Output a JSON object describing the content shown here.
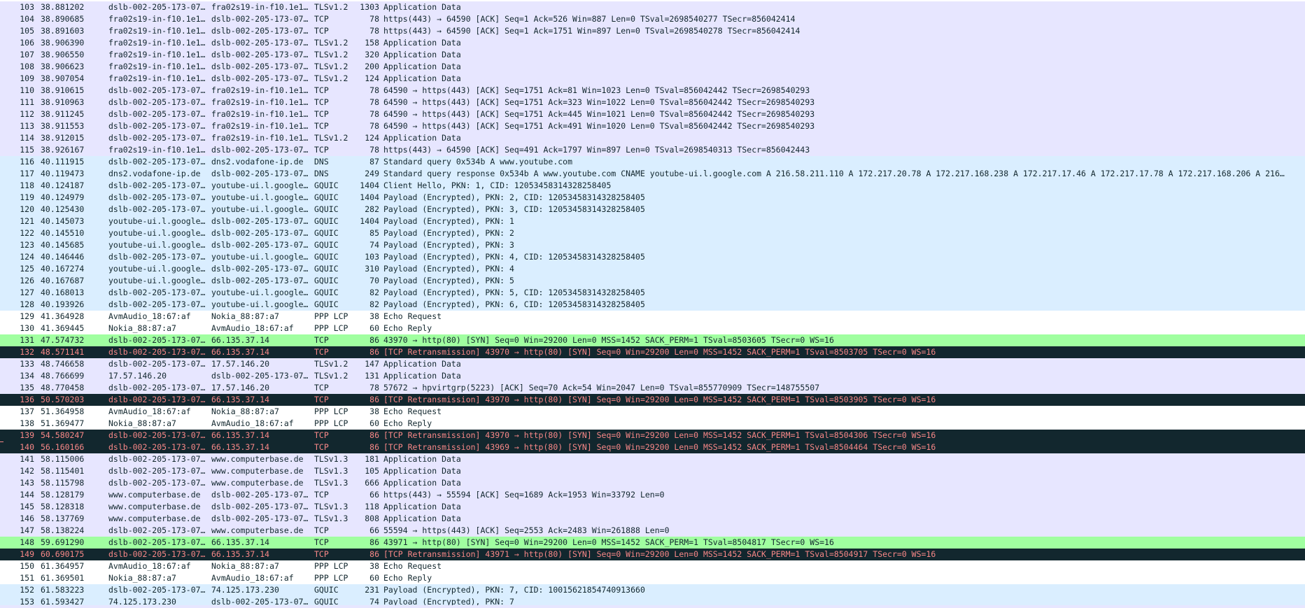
{
  "colors": {
    "tcp": "#e7e6ff",
    "udp": "#daeeff",
    "ppp": "#ffffff",
    "syn": "#a0ffa0",
    "bad": "#12272e"
  },
  "text_colors": {
    "tcp": "#12272e",
    "udp": "#12272e",
    "ppp": "#12272e",
    "syn": "#12272e",
    "bad": "#f78787"
  },
  "packets": [
    {
      "no": "103",
      "time": "38.881202",
      "src": "dslb-002-205-173-07…",
      "dst": "fra02s19-in-f10.1e1…",
      "proto": "TLSv1.2",
      "len": "1303",
      "info": "Application Data",
      "color": "tcp"
    },
    {
      "no": "104",
      "time": "38.890685",
      "src": "fra02s19-in-f10.1e1…",
      "dst": "dslb-002-205-173-07…",
      "proto": "TCP",
      "len": "78",
      "info": "https(443) → 64590 [ACK] Seq=1 Ack=526 Win=887 Len=0 TSval=2698540277 TSecr=856042414",
      "color": "tcp"
    },
    {
      "no": "105",
      "time": "38.891603",
      "src": "fra02s19-in-f10.1e1…",
      "dst": "dslb-002-205-173-07…",
      "proto": "TCP",
      "len": "78",
      "info": "https(443) → 64590 [ACK] Seq=1 Ack=1751 Win=897 Len=0 TSval=2698540278 TSecr=856042414",
      "color": "tcp"
    },
    {
      "no": "106",
      "time": "38.906390",
      "src": "fra02s19-in-f10.1e1…",
      "dst": "dslb-002-205-173-07…",
      "proto": "TLSv1.2",
      "len": "158",
      "info": "Application Data",
      "color": "tcp"
    },
    {
      "no": "107",
      "time": "38.906550",
      "src": "fra02s19-in-f10.1e1…",
      "dst": "dslb-002-205-173-07…",
      "proto": "TLSv1.2",
      "len": "320",
      "info": "Application Data",
      "color": "tcp"
    },
    {
      "no": "108",
      "time": "38.906623",
      "src": "fra02s19-in-f10.1e1…",
      "dst": "dslb-002-205-173-07…",
      "proto": "TLSv1.2",
      "len": "200",
      "info": "Application Data",
      "color": "tcp"
    },
    {
      "no": "109",
      "time": "38.907054",
      "src": "fra02s19-in-f10.1e1…",
      "dst": "dslb-002-205-173-07…",
      "proto": "TLSv1.2",
      "len": "124",
      "info": "Application Data",
      "color": "tcp"
    },
    {
      "no": "110",
      "time": "38.910615",
      "src": "dslb-002-205-173-07…",
      "dst": "fra02s19-in-f10.1e1…",
      "proto": "TCP",
      "len": "78",
      "info": "64590 → https(443) [ACK] Seq=1751 Ack=81 Win=1023 Len=0 TSval=856042442 TSecr=2698540293",
      "color": "tcp"
    },
    {
      "no": "111",
      "time": "38.910963",
      "src": "dslb-002-205-173-07…",
      "dst": "fra02s19-in-f10.1e1…",
      "proto": "TCP",
      "len": "78",
      "info": "64590 → https(443) [ACK] Seq=1751 Ack=323 Win=1022 Len=0 TSval=856042442 TSecr=2698540293",
      "color": "tcp"
    },
    {
      "no": "112",
      "time": "38.911245",
      "src": "dslb-002-205-173-07…",
      "dst": "fra02s19-in-f10.1e1…",
      "proto": "TCP",
      "len": "78",
      "info": "64590 → https(443) [ACK] Seq=1751 Ack=445 Win=1021 Len=0 TSval=856042442 TSecr=2698540293",
      "color": "tcp"
    },
    {
      "no": "113",
      "time": "38.911553",
      "src": "dslb-002-205-173-07…",
      "dst": "fra02s19-in-f10.1e1…",
      "proto": "TCP",
      "len": "78",
      "info": "64590 → https(443) [ACK] Seq=1751 Ack=491 Win=1020 Len=0 TSval=856042442 TSecr=2698540293",
      "color": "tcp"
    },
    {
      "no": "114",
      "time": "38.912015",
      "src": "dslb-002-205-173-07…",
      "dst": "fra02s19-in-f10.1e1…",
      "proto": "TLSv1.2",
      "len": "124",
      "info": "Application Data",
      "color": "tcp"
    },
    {
      "no": "115",
      "time": "38.926167",
      "src": "fra02s19-in-f10.1e1…",
      "dst": "dslb-002-205-173-07…",
      "proto": "TCP",
      "len": "78",
      "info": "https(443) → 64590 [ACK] Seq=491 Ack=1797 Win=897 Len=0 TSval=2698540313 TSecr=856042443",
      "color": "tcp"
    },
    {
      "no": "116",
      "time": "40.111915",
      "src": "dslb-002-205-173-07…",
      "dst": "dns2.vodafone-ip.de",
      "proto": "DNS",
      "len": "87",
      "info": "Standard query 0x534b A www.youtube.com",
      "color": "udp"
    },
    {
      "no": "117",
      "time": "40.119473",
      "src": "dns2.vodafone-ip.de",
      "dst": "dslb-002-205-173-07…",
      "proto": "DNS",
      "len": "249",
      "info": "Standard query response 0x534b A www.youtube.com CNAME youtube-ui.l.google.com A 216.58.211.110 A 172.217.20.78 A 172.217.168.238 A 172.217.17.46 A 172.217.17.78 A 172.217.168.206 A 216…",
      "color": "udp"
    },
    {
      "no": "118",
      "time": "40.124187",
      "src": "dslb-002-205-173-07…",
      "dst": "youtube-ui.l.google…",
      "proto": "GQUIC",
      "len": "1404",
      "info": "Client Hello, PKN: 1, CID: 12053458314328258405",
      "color": "udp"
    },
    {
      "no": "119",
      "time": "40.124979",
      "src": "dslb-002-205-173-07…",
      "dst": "youtube-ui.l.google…",
      "proto": "GQUIC",
      "len": "1404",
      "info": "Payload (Encrypted), PKN: 2, CID: 12053458314328258405",
      "color": "udp"
    },
    {
      "no": "120",
      "time": "40.125430",
      "src": "dslb-002-205-173-07…",
      "dst": "youtube-ui.l.google…",
      "proto": "GQUIC",
      "len": "282",
      "info": "Payload (Encrypted), PKN: 3, CID: 12053458314328258405",
      "color": "udp"
    },
    {
      "no": "121",
      "time": "40.145073",
      "src": "youtube-ui.l.google…",
      "dst": "dslb-002-205-173-07…",
      "proto": "GQUIC",
      "len": "1404",
      "info": "Payload (Encrypted), PKN: 1",
      "color": "udp"
    },
    {
      "no": "122",
      "time": "40.145510",
      "src": "youtube-ui.l.google…",
      "dst": "dslb-002-205-173-07…",
      "proto": "GQUIC",
      "len": "85",
      "info": "Payload (Encrypted), PKN: 2",
      "color": "udp"
    },
    {
      "no": "123",
      "time": "40.145685",
      "src": "youtube-ui.l.google…",
      "dst": "dslb-002-205-173-07…",
      "proto": "GQUIC",
      "len": "74",
      "info": "Payload (Encrypted), PKN: 3",
      "color": "udp"
    },
    {
      "no": "124",
      "time": "40.146446",
      "src": "dslb-002-205-173-07…",
      "dst": "youtube-ui.l.google…",
      "proto": "GQUIC",
      "len": "103",
      "info": "Payload (Encrypted), PKN: 4, CID: 12053458314328258405",
      "color": "udp"
    },
    {
      "no": "125",
      "time": "40.167274",
      "src": "youtube-ui.l.google…",
      "dst": "dslb-002-205-173-07…",
      "proto": "GQUIC",
      "len": "310",
      "info": "Payload (Encrypted), PKN: 4",
      "color": "udp"
    },
    {
      "no": "126",
      "time": "40.167687",
      "src": "youtube-ui.l.google…",
      "dst": "dslb-002-205-173-07…",
      "proto": "GQUIC",
      "len": "70",
      "info": "Payload (Encrypted), PKN: 5",
      "color": "udp"
    },
    {
      "no": "127",
      "time": "40.168013",
      "src": "dslb-002-205-173-07…",
      "dst": "youtube-ui.l.google…",
      "proto": "GQUIC",
      "len": "82",
      "info": "Payload (Encrypted), PKN: 5, CID: 12053458314328258405",
      "color": "udp"
    },
    {
      "no": "128",
      "time": "40.193926",
      "src": "dslb-002-205-173-07…",
      "dst": "youtube-ui.l.google…",
      "proto": "GQUIC",
      "len": "82",
      "info": "Payload (Encrypted), PKN: 6, CID: 12053458314328258405",
      "color": "udp"
    },
    {
      "no": "129",
      "time": "41.364928",
      "src": "AvmAudio_18:67:af",
      "dst": "Nokia_88:87:a7",
      "proto": "PPP LCP",
      "len": "38",
      "info": "Echo Request",
      "color": "ppp"
    },
    {
      "no": "130",
      "time": "41.369445",
      "src": "Nokia_88:87:a7",
      "dst": "AvmAudio_18:67:af",
      "proto": "PPP LCP",
      "len": "60",
      "info": "Echo Reply",
      "color": "ppp"
    },
    {
      "no": "131",
      "time": "47.574732",
      "src": "dslb-002-205-173-07…",
      "dst": "66.135.37.14",
      "proto": "TCP",
      "len": "86",
      "info": "43970 → http(80) [SYN] Seq=0 Win=29200 Len=0 MSS=1452 SACK_PERM=1 TSval=8503605 TSecr=0 WS=16",
      "color": "syn"
    },
    {
      "no": "132",
      "time": "48.571141",
      "src": "dslb-002-205-173-07…",
      "dst": "66.135.37.14",
      "proto": "TCP",
      "len": "86",
      "info": "[TCP Retransmission] 43970 → http(80) [SYN] Seq=0 Win=29200 Len=0 MSS=1452 SACK_PERM=1 TSval=8503705 TSecr=0 WS=16",
      "color": "bad"
    },
    {
      "no": "133",
      "time": "48.746658",
      "src": "dslb-002-205-173-07…",
      "dst": "17.57.146.20",
      "proto": "TLSv1.2",
      "len": "147",
      "info": "Application Data",
      "color": "tcp"
    },
    {
      "no": "134",
      "time": "48.766699",
      "src": "17.57.146.20",
      "dst": "dslb-002-205-173-07…",
      "proto": "TLSv1.2",
      "len": "131",
      "info": "Application Data",
      "color": "tcp"
    },
    {
      "no": "135",
      "time": "48.770458",
      "src": "dslb-002-205-173-07…",
      "dst": "17.57.146.20",
      "proto": "TCP",
      "len": "78",
      "info": "57672 → hpvirtgrp(5223) [ACK] Seq=70 Ack=54 Win=2047 Len=0 TSval=855770909 TSecr=148755507",
      "color": "tcp"
    },
    {
      "no": "136",
      "time": "50.570203",
      "src": "dslb-002-205-173-07…",
      "dst": "66.135.37.14",
      "proto": "TCP",
      "len": "86",
      "info": "[TCP Retransmission] 43970 → http(80) [SYN] Seq=0 Win=29200 Len=0 MSS=1452 SACK_PERM=1 TSval=8503905 TSecr=0 WS=16",
      "color": "bad"
    },
    {
      "no": "137",
      "time": "51.364958",
      "src": "AvmAudio_18:67:af",
      "dst": "Nokia_88:87:a7",
      "proto": "PPP LCP",
      "len": "38",
      "info": "Echo Request",
      "color": "ppp"
    },
    {
      "no": "138",
      "time": "51.369477",
      "src": "Nokia_88:87:a7",
      "dst": "AvmAudio_18:67:af",
      "proto": "PPP LCP",
      "len": "60",
      "info": "Echo Reply",
      "color": "ppp"
    },
    {
      "no": "139",
      "time": "54.580247",
      "src": "dslb-002-205-173-07…",
      "dst": "66.135.37.14",
      "proto": "TCP",
      "len": "86",
      "info": "[TCP Retransmission] 43970 → http(80) [SYN] Seq=0 Win=29200 Len=0 MSS=1452 SACK_PERM=1 TSval=8504306 TSecr=0 WS=16",
      "color": "bad"
    },
    {
      "no": "140",
      "time": "56.160166",
      "src": "dslb-002-205-173-07…",
      "dst": "66.135.37.14",
      "proto": "TCP",
      "len": "86",
      "info": "[TCP Retransmission] 43969 → http(80) [SYN] Seq=0 Win=29200 Len=0 MSS=1452 SACK_PERM=1 TSval=8504464 TSecr=0 WS=16",
      "color": "bad",
      "marker": true
    },
    {
      "no": "141",
      "time": "58.115006",
      "src": "dslb-002-205-173-07…",
      "dst": "www.computerbase.de",
      "proto": "TLSv1.3",
      "len": "181",
      "info": "Application Data",
      "color": "tcp"
    },
    {
      "no": "142",
      "time": "58.115401",
      "src": "dslb-002-205-173-07…",
      "dst": "www.computerbase.de",
      "proto": "TLSv1.3",
      "len": "105",
      "info": "Application Data",
      "color": "tcp"
    },
    {
      "no": "143",
      "time": "58.115798",
      "src": "dslb-002-205-173-07…",
      "dst": "www.computerbase.de",
      "proto": "TLSv1.3",
      "len": "666",
      "info": "Application Data",
      "color": "tcp"
    },
    {
      "no": "144",
      "time": "58.128179",
      "src": "www.computerbase.de",
      "dst": "dslb-002-205-173-07…",
      "proto": "TCP",
      "len": "66",
      "info": "https(443) → 55594 [ACK] Seq=1689 Ack=1953 Win=33792 Len=0",
      "color": "tcp"
    },
    {
      "no": "145",
      "time": "58.128318",
      "src": "www.computerbase.de",
      "dst": "dslb-002-205-173-07…",
      "proto": "TLSv1.3",
      "len": "118",
      "info": "Application Data",
      "color": "tcp"
    },
    {
      "no": "146",
      "time": "58.137769",
      "src": "www.computerbase.de",
      "dst": "dslb-002-205-173-07…",
      "proto": "TLSv1.3",
      "len": "808",
      "info": "Application Data",
      "color": "tcp"
    },
    {
      "no": "147",
      "time": "58.138224",
      "src": "dslb-002-205-173-07…",
      "dst": "www.computerbase.de",
      "proto": "TCP",
      "len": "66",
      "info": "55594 → https(443) [ACK] Seq=2553 Ack=2483 Win=261888 Len=0",
      "color": "tcp"
    },
    {
      "no": "148",
      "time": "59.691290",
      "src": "dslb-002-205-173-07…",
      "dst": "66.135.37.14",
      "proto": "TCP",
      "len": "86",
      "info": "43971 → http(80) [SYN] Seq=0 Win=29200 Len=0 MSS=1452 SACK_PERM=1 TSval=8504817 TSecr=0 WS=16",
      "color": "syn"
    },
    {
      "no": "149",
      "time": "60.690175",
      "src": "dslb-002-205-173-07…",
      "dst": "66.135.37.14",
      "proto": "TCP",
      "len": "86",
      "info": "[TCP Retransmission] 43971 → http(80) [SYN] Seq=0 Win=29200 Len=0 MSS=1452 SACK_PERM=1 TSval=8504917 TSecr=0 WS=16",
      "color": "bad"
    },
    {
      "no": "150",
      "time": "61.364957",
      "src": "AvmAudio_18:67:af",
      "dst": "Nokia_88:87:a7",
      "proto": "PPP LCP",
      "len": "38",
      "info": "Echo Request",
      "color": "ppp"
    },
    {
      "no": "151",
      "time": "61.369501",
      "src": "Nokia_88:87:a7",
      "dst": "AvmAudio_18:67:af",
      "proto": "PPP LCP",
      "len": "60",
      "info": "Echo Reply",
      "color": "ppp"
    },
    {
      "no": "152",
      "time": "61.583223",
      "src": "dslb-002-205-173-07…",
      "dst": "74.125.173.230",
      "proto": "GQUIC",
      "len": "231",
      "info": "Payload (Encrypted), PKN: 7, CID: 10015621854740913660",
      "color": "udp"
    },
    {
      "no": "153",
      "time": "61.593427",
      "src": "74.125.173.230",
      "dst": "dslb-002-205-173-07…",
      "proto": "GQUIC",
      "len": "74",
      "info": "Payload (Encrypted), PKN: 7",
      "color": "udp"
    }
  ]
}
